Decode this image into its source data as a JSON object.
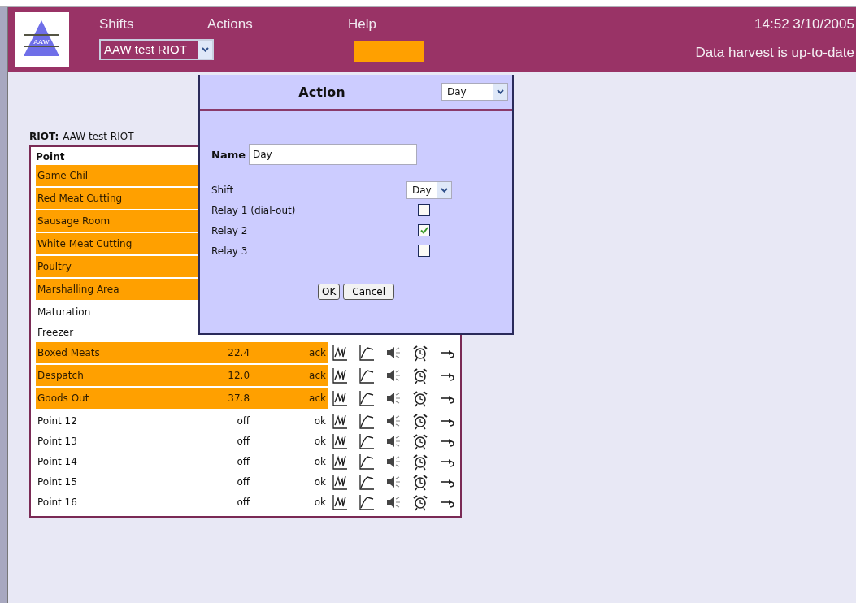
{
  "header": {
    "logo_text": "AAW",
    "menus": [
      "Shifts",
      "Actions",
      "Help"
    ],
    "riot_select": "AAW test RIOT",
    "alarm_indicator": {
      "color": "#ffa000"
    },
    "datetime": "14:52 3/10/2005",
    "harvest_status": "Data harvest is up-to-date"
  },
  "riot": {
    "label": "RIOT:",
    "name": "AAW test RIOT"
  },
  "table": {
    "columns": [
      "Point"
    ],
    "rows": [
      {
        "name": "Game Chil",
        "alarm": true
      },
      {
        "name": "Red Meat Cutting",
        "alarm": true
      },
      {
        "name": "Sausage Room",
        "alarm": true
      },
      {
        "name": "White Meat Cutting",
        "alarm": true
      },
      {
        "name": "Poultry",
        "alarm": true
      },
      {
        "name": "Marshalling Area",
        "alarm": true
      },
      {
        "name": "Maturation",
        "alarm": false
      },
      {
        "name": "Freezer",
        "alarm": false
      },
      {
        "name": "Boxed Meats",
        "alarm": true,
        "value": "22.4",
        "status": "ack"
      },
      {
        "name": "Despatch",
        "alarm": true,
        "value": "12.0",
        "status": "ack"
      },
      {
        "name": "Goods Out",
        "alarm": true,
        "value": "37.8",
        "status": "ack"
      },
      {
        "name": "Point 12",
        "alarm": false,
        "value": "off",
        "status": "ok"
      },
      {
        "name": "Point 13",
        "alarm": false,
        "value": "off",
        "status": "ok"
      },
      {
        "name": "Point 14",
        "alarm": false,
        "value": "off",
        "status": "ok"
      },
      {
        "name": "Point 15",
        "alarm": false,
        "value": "off",
        "status": "ok"
      },
      {
        "name": "Point 16",
        "alarm": false,
        "value": "off",
        "status": "ok"
      }
    ]
  },
  "dialog": {
    "title": "Action",
    "action_select": "Day",
    "name_label": "Name",
    "name_value": "Day",
    "fields": [
      {
        "kind": "select",
        "label": "Shift",
        "value": "Day"
      },
      {
        "kind": "checkbox",
        "label": "Relay 1 (dial-out)",
        "checked": false
      },
      {
        "kind": "checkbox",
        "label": "Relay 2",
        "checked": true
      },
      {
        "kind": "checkbox",
        "label": "Relay 3",
        "checked": false
      }
    ],
    "buttons": [
      "OK",
      "Cancel"
    ]
  }
}
